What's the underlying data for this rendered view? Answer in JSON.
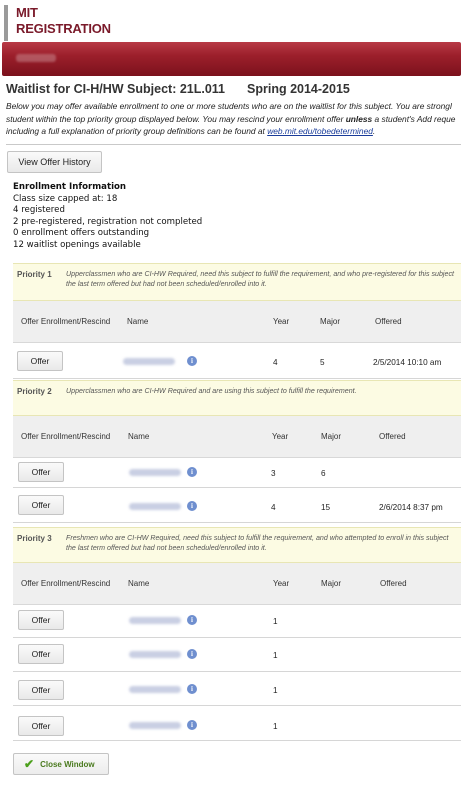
{
  "header": {
    "logo_line1": "MIT",
    "logo_line2": "REGISTRATION"
  },
  "title": {
    "subject": "Waitlist for CI-H/HW Subject: 21L.011",
    "term": "Spring 2014-2015"
  },
  "intro": {
    "line1": "Below you may offer available enrollment to one or more students who are on the waitlist for this subject.  You are strongl",
    "line2a": "student within the top priority group displayed below. You may rescind your enrollment offer ",
    "line2b": "unless",
    "line2c": " a student's Add reque",
    "line3a": "including a full explanation of priority group definitions can be found at ",
    "link": "web.mit.edu/tobedetermined",
    "line3b": "."
  },
  "buttons": {
    "view_history": "View Offer History",
    "close_window": "Close Window"
  },
  "enrollment": {
    "heading": "Enrollment Information",
    "lines": [
      "Class size capped at: 18",
      " 4 registered",
      " 2 pre-registered, registration not completed",
      " 0 enrollment offers outstanding",
      "12 waitlist openings available"
    ]
  },
  "columns": {
    "offer": "Offer Enrollment/Rescind",
    "name": "Name",
    "year": "Year",
    "major": "Major",
    "offered": "Offered"
  },
  "offer_label": "Offer",
  "info_glyph": "i",
  "priorities": [
    {
      "label": "Priority 1",
      "description": "Upperclassmen who are CI-HW Required, need this subject to fulfill the requirement, and who pre-registered for this subject the last term offered but had not been scheduled/enrolled into it.",
      "rows": [
        {
          "year": "4",
          "major": "5",
          "offered": "2/5/2014 10:10 am"
        }
      ]
    },
    {
      "label": "Priority 2",
      "description": "Upperclassmen who are CI-HW Required and are using this subject to fulfill the requirement.",
      "rows": [
        {
          "year": "3",
          "major": "6",
          "offered": ""
        },
        {
          "year": "4",
          "major": "15",
          "offered": "2/6/2014  8:37 pm"
        }
      ]
    },
    {
      "label": "Priority 3",
      "description": "Freshmen who are CI-HW Required, need this subject to fulfill the requirement, and who attempted to enroll in this subject the last term offered but had not been scheduled/enrolled into it.",
      "rows": [
        {
          "year": "1",
          "major": "",
          "offered": ""
        },
        {
          "year": "1",
          "major": "",
          "offered": ""
        },
        {
          "year": "1",
          "major": "",
          "offered": ""
        },
        {
          "year": "1",
          "major": "",
          "offered": ""
        }
      ]
    }
  ],
  "colors": {
    "brand": "#7a1a2a",
    "banner": "#9c1f2b",
    "priority_bg": "#fcfbe3",
    "link": "#1a3c9a",
    "check": "#4ca01c"
  }
}
